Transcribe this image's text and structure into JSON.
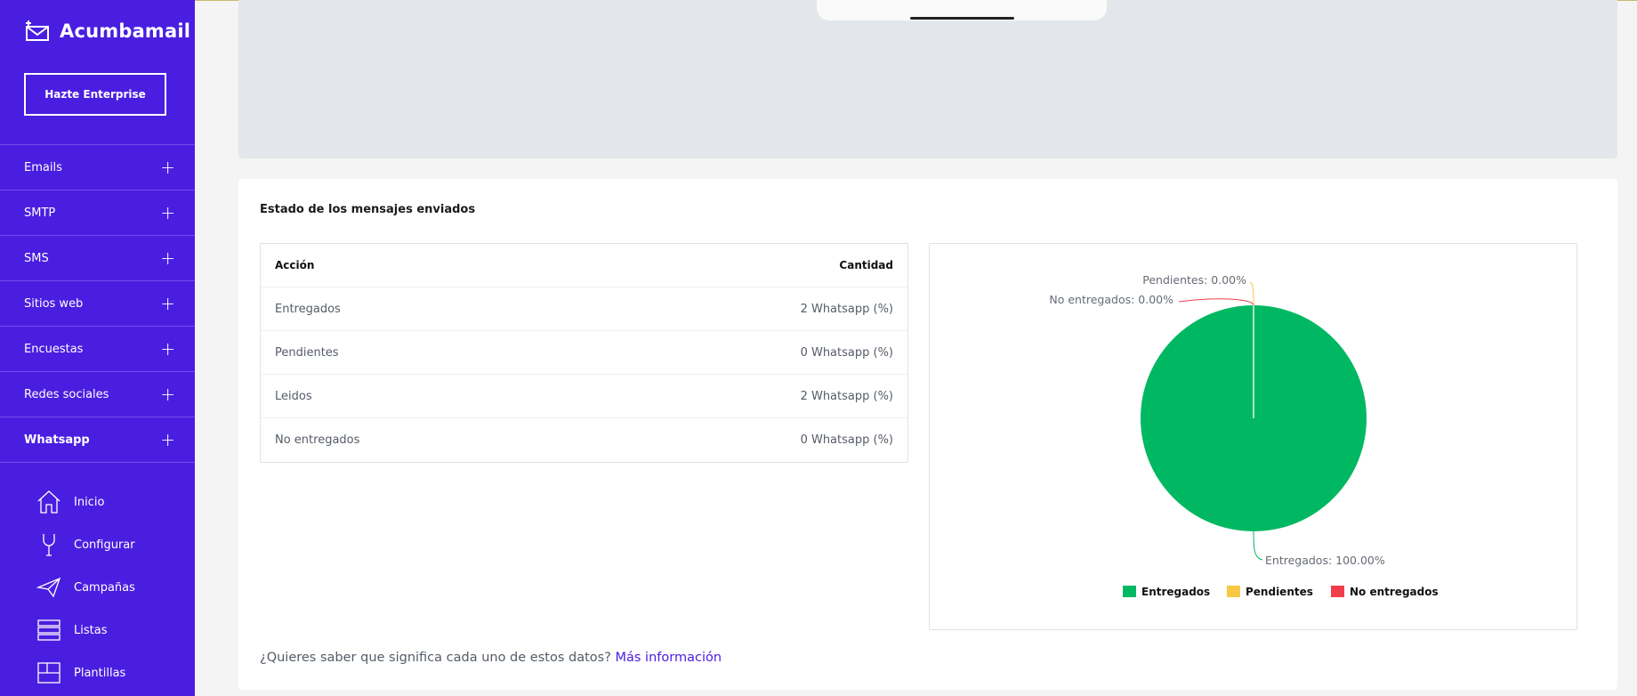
{
  "brand": {
    "name": "Acumbamail"
  },
  "sidebar": {
    "enterprise_button": "Hazte Enterprise",
    "menu": [
      {
        "label": "Emails",
        "active": false
      },
      {
        "label": "SMTP",
        "active": false
      },
      {
        "label": "SMS",
        "active": false
      },
      {
        "label": "Sitios web",
        "active": false
      },
      {
        "label": "Encuestas",
        "active": false
      },
      {
        "label": "Redes sociales",
        "active": false
      },
      {
        "label": "Whatsapp",
        "active": true
      }
    ],
    "submenu": [
      {
        "label": "Inicio",
        "icon": "home-icon"
      },
      {
        "label": "Configurar",
        "icon": "wrench-icon"
      },
      {
        "label": "Campañas",
        "icon": "paper-plane-icon"
      },
      {
        "label": "Listas",
        "icon": "list-icon"
      },
      {
        "label": "Plantillas",
        "icon": "template-icon"
      }
    ]
  },
  "card": {
    "title": "Estado de los mensajes enviados",
    "table": {
      "headers": {
        "action": "Acción",
        "quantity": "Cantidad"
      },
      "rows": [
        {
          "action": "Entregados",
          "quantity": "2 Whatsapp (%)"
        },
        {
          "action": "Pendientes",
          "quantity": "0 Whatsapp (%)"
        },
        {
          "action": "Leidos",
          "quantity": "2 Whatsapp (%)"
        },
        {
          "action": "No entregados",
          "quantity": "0 Whatsapp (%)"
        }
      ]
    },
    "footer_text": "¿Quieres saber que significa cada uno de estos datos?",
    "footer_link": "Más información"
  },
  "colors": {
    "sidebar": "#4a1ee0",
    "green": "#00b862",
    "yellow": "#f7c844",
    "red": "#f03e4d"
  },
  "chart_data": {
    "type": "pie",
    "slices": [
      {
        "label": "Entregados",
        "value": 100.0,
        "display": "Entregados: 100.00%",
        "color": "#00b862"
      },
      {
        "label": "Pendientes",
        "value": 0.0,
        "display": "Pendientes: 0.00%",
        "color": "#f7c844"
      },
      {
        "label": "No entregados",
        "value": 0.0,
        "display": "No entregados: 0.00%",
        "color": "#f03e4d"
      }
    ],
    "legend": [
      "Entregados",
      "Pendientes",
      "No entregados"
    ],
    "legend_position": "bottom"
  }
}
